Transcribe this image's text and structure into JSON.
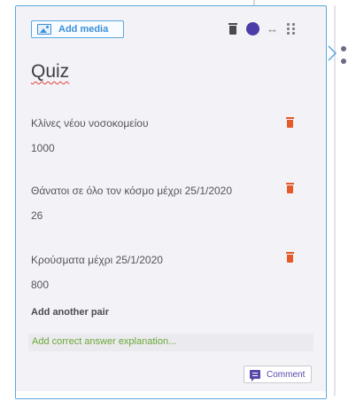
{
  "toolbar": {
    "add_media_label": "Add media",
    "icons": [
      "image-icon",
      "trash-icon",
      "color-dot-icon",
      "resize-horizontal-icon",
      "drag-handle-icon"
    ],
    "resize_glyph": "↔"
  },
  "quiz": {
    "title": "Quiz",
    "pairs": [
      {
        "question": "Κλίνες νέου νοσοκομείου",
        "answer": "1000"
      },
      {
        "question": "Θάνατοι σε όλο τον κόσμο μέχρι 25/1/2020",
        "answer": "26"
      },
      {
        "question": "Κρούσματα μέχρι 25/1/2020",
        "answer": "800"
      }
    ],
    "add_pair_label": "Add another pair",
    "explanation_placeholder": "Add correct answer explanation..."
  },
  "comment": {
    "label": "Comment"
  },
  "colors": {
    "accent_blue": "#3b8fd6",
    "card_border": "#5aa8e0",
    "delete_red": "#e35a2b",
    "purple": "#4b3ca8",
    "explanation_green": "#6aa837"
  }
}
